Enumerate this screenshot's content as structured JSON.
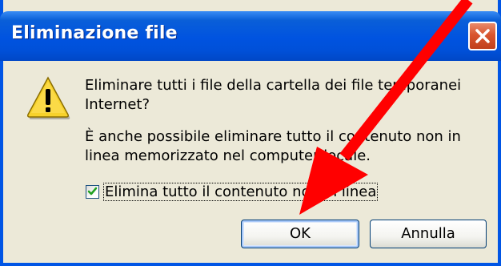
{
  "dialog": {
    "title": "Eliminazione file",
    "message_line1": "Eliminare tutti i file della cartella dei file temporanei",
    "message_line2": "Internet?",
    "message_line3": "È anche possibile eliminare tutto il contenuto non in",
    "message_line4": "linea memorizzato nel computer locale.",
    "checkbox_label": "Elimina tutto il contenuto non in linea",
    "checkbox_checked": true,
    "ok_label": "OK",
    "cancel_label": "Annulla"
  },
  "icons": {
    "title_close": "close-icon",
    "warning": "warning-icon",
    "checkmark": "check-icon",
    "annotation": "red-arrow-annotation"
  },
  "colors": {
    "titlebar": "#0053e0",
    "close_button": "#d9552f",
    "dialog_bg": "#ece9d8",
    "arrow": "#ff0000",
    "checkmark": "#21a121"
  }
}
